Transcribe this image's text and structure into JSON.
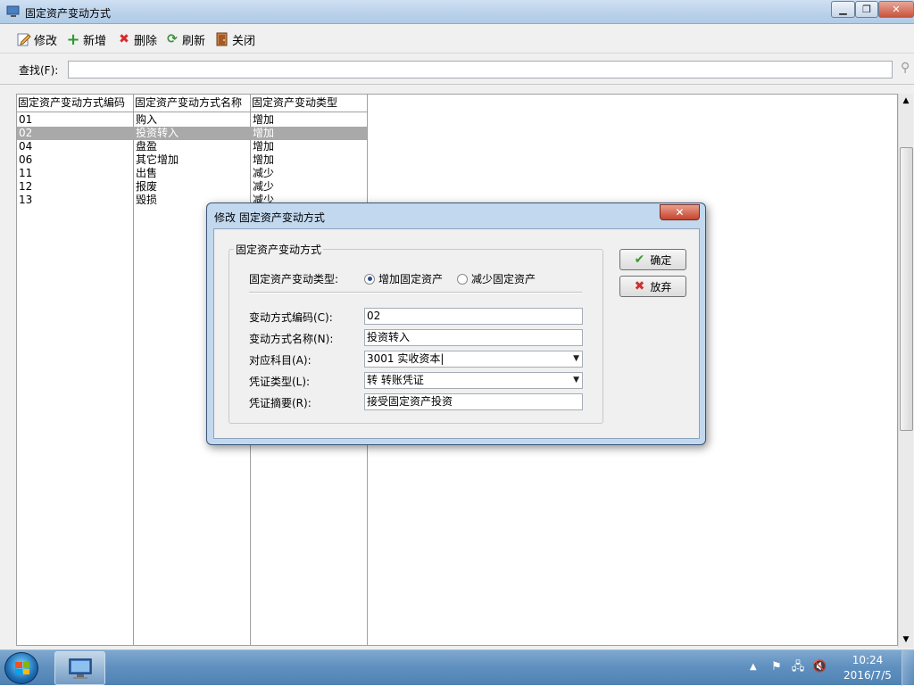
{
  "window": {
    "title": "固定资产变动方式"
  },
  "toolbar": {
    "edit": "修改",
    "add": "新增",
    "delete": "删除",
    "refresh": "刷新",
    "close": "关闭"
  },
  "search": {
    "label": "查找(F):",
    "value": ""
  },
  "table": {
    "headers": [
      "固定资产变动方式编码",
      "固定资产变动方式名称",
      "固定资产变动类型"
    ],
    "rows": [
      {
        "code": "01",
        "name": "购入",
        "type": "增加"
      },
      {
        "code": "02",
        "name": "投资转入",
        "type": "增加"
      },
      {
        "code": "04",
        "name": "盘盈",
        "type": "增加"
      },
      {
        "code": "06",
        "name": "其它增加",
        "type": "增加"
      },
      {
        "code": "11",
        "name": "出售",
        "type": "减少"
      },
      {
        "code": "12",
        "name": "报废",
        "type": "减少"
      },
      {
        "code": "13",
        "name": "毁损",
        "type": "减少"
      }
    ],
    "selected_row": 1
  },
  "dialog": {
    "title": "修改 固定资产变动方式",
    "group_title": "固定资产变动方式",
    "type_label": "固定资产变动类型:",
    "radio_increase": "增加固定资产",
    "radio_decrease": "减少固定资产",
    "selected_radio": "increase",
    "code_label": "变动方式编码(C):",
    "code_value": "02",
    "name_label": "变动方式名称(N):",
    "name_value": "投资转入",
    "account_label": "对应科目(A):",
    "account_value": "3001   实收资本|",
    "voucher_type_label": "凭证类型(L):",
    "voucher_type_value": "转   转账凭证",
    "summary_label": "凭证摘要(R):",
    "summary_value": "接受固定资产投资",
    "ok_label": "确定",
    "cancel_label": "放弃"
  },
  "taskbar": {
    "time": "10:24",
    "date": "2016/7/5"
  },
  "colors": {
    "selection": "#a9a9a9",
    "titlebar": "#b9d1ea",
    "ok_check": "#3d9a2b",
    "cancel_x": "#d32f2f"
  }
}
